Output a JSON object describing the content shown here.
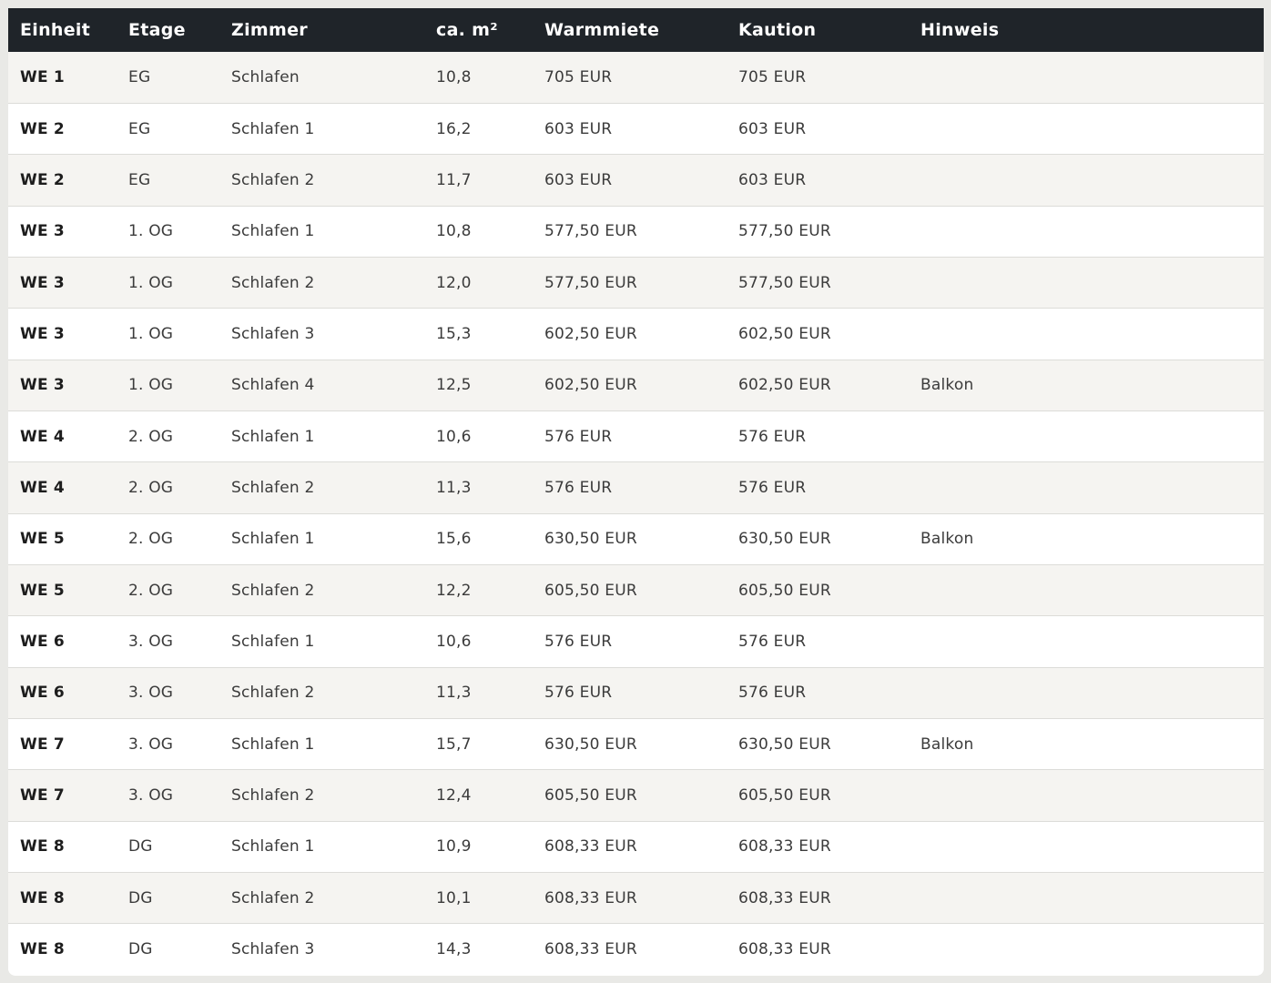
{
  "table": {
    "headers": [
      "Einheit",
      "Etage",
      "Zimmer",
      "ca. m²",
      "Warmmiete",
      "Kaution",
      "Hinweis"
    ],
    "rows": [
      {
        "einheit": "WE 1",
        "etage": "EG",
        "zimmer": "Schlafen",
        "flaeche": "10,8",
        "warmmiete": "705 EUR",
        "kaution": "705 EUR",
        "hinweis": ""
      },
      {
        "einheit": "WE 2",
        "etage": "EG",
        "zimmer": "Schlafen 1",
        "flaeche": "16,2",
        "warmmiete": "603 EUR",
        "kaution": "603 EUR",
        "hinweis": ""
      },
      {
        "einheit": "WE 2",
        "etage": "EG",
        "zimmer": "Schlafen 2",
        "flaeche": "11,7",
        "warmmiete": "603 EUR",
        "kaution": "603 EUR",
        "hinweis": ""
      },
      {
        "einheit": "WE 3",
        "etage": "1. OG",
        "zimmer": "Schlafen 1",
        "flaeche": "10,8",
        "warmmiete": "577,50 EUR",
        "kaution": "577,50 EUR",
        "hinweis": ""
      },
      {
        "einheit": "WE 3",
        "etage": "1. OG",
        "zimmer": "Schlafen 2",
        "flaeche": "12,0",
        "warmmiete": "577,50 EUR",
        "kaution": "577,50 EUR",
        "hinweis": ""
      },
      {
        "einheit": "WE 3",
        "etage": "1. OG",
        "zimmer": "Schlafen 3",
        "flaeche": "15,3",
        "warmmiete": "602,50 EUR",
        "kaution": "602,50 EUR",
        "hinweis": ""
      },
      {
        "einheit": "WE 3",
        "etage": "1. OG",
        "zimmer": "Schlafen 4",
        "flaeche": "12,5",
        "warmmiete": "602,50 EUR",
        "kaution": "602,50 EUR",
        "hinweis": "Balkon"
      },
      {
        "einheit": "WE 4",
        "etage": "2. OG",
        "zimmer": "Schlafen 1",
        "flaeche": "10,6",
        "warmmiete": "576 EUR",
        "kaution": "576 EUR",
        "hinweis": ""
      },
      {
        "einheit": "WE 4",
        "etage": "2. OG",
        "zimmer": "Schlafen 2",
        "flaeche": "11,3",
        "warmmiete": "576 EUR",
        "kaution": "576 EUR",
        "hinweis": ""
      },
      {
        "einheit": "WE 5",
        "etage": "2. OG",
        "zimmer": "Schlafen 1",
        "flaeche": "15,6",
        "warmmiete": "630,50 EUR",
        "kaution": "630,50 EUR",
        "hinweis": "Balkon"
      },
      {
        "einheit": "WE 5",
        "etage": "2. OG",
        "zimmer": "Schlafen 2",
        "flaeche": "12,2",
        "warmmiete": "605,50 EUR",
        "kaution": "605,50 EUR",
        "hinweis": ""
      },
      {
        "einheit": "WE 6",
        "etage": "3. OG",
        "zimmer": "Schlafen 1",
        "flaeche": "10,6",
        "warmmiete": "576 EUR",
        "kaution": "576 EUR",
        "hinweis": ""
      },
      {
        "einheit": "WE 6",
        "etage": "3. OG",
        "zimmer": "Schlafen 2",
        "flaeche": "11,3",
        "warmmiete": "576 EUR",
        "kaution": "576 EUR",
        "hinweis": ""
      },
      {
        "einheit": "WE 7",
        "etage": "3. OG",
        "zimmer": "Schlafen 1",
        "flaeche": "15,7",
        "warmmiete": "630,50 EUR",
        "kaution": "630,50 EUR",
        "hinweis": "Balkon"
      },
      {
        "einheit": "WE 7",
        "etage": "3. OG",
        "zimmer": "Schlafen 2",
        "flaeche": "12,4",
        "warmmiete": "605,50 EUR",
        "kaution": "605,50 EUR",
        "hinweis": ""
      },
      {
        "einheit": "WE 8",
        "etage": "DG",
        "zimmer": "Schlafen 1",
        "flaeche": "10,9",
        "warmmiete": "608,33 EUR",
        "kaution": "608,33 EUR",
        "hinweis": ""
      },
      {
        "einheit": "WE 8",
        "etage": "DG",
        "zimmer": "Schlafen 2",
        "flaeche": "10,1",
        "warmmiete": "608,33 EUR",
        "kaution": "608,33 EUR",
        "hinweis": ""
      },
      {
        "einheit": "WE 8",
        "etage": "DG",
        "zimmer": "Schlafen 3",
        "flaeche": "14,3",
        "warmmiete": "608,33 EUR",
        "kaution": "608,33 EUR",
        "hinweis": ""
      }
    ]
  },
  "colors": {
    "header_bg": "#1f2429",
    "header_text": "#ffffff",
    "row_odd": "#f5f4f1",
    "row_even": "#ffffff",
    "page_bg": "#e9e9e6"
  }
}
